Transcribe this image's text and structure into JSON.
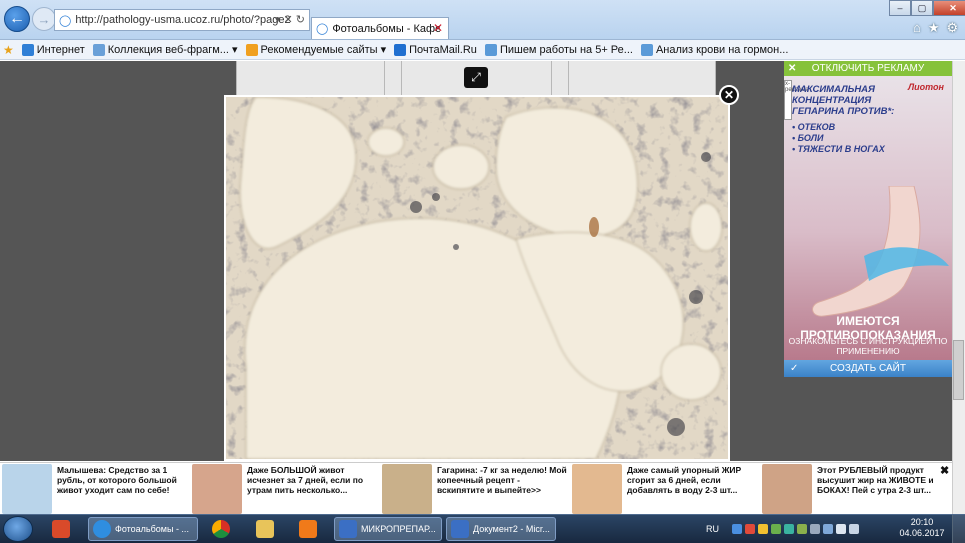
{
  "browser": {
    "url": "http://pathology-usma.ucoz.ru/photo/?page2",
    "tab_title": "Фотоальбомы - Кафедра ...",
    "address_tools": "▾ ✕ ↻",
    "window_controls": [
      "–",
      "▢",
      "✕"
    ],
    "toolbar_icons": [
      "home-icon",
      "star-icon",
      "gear-icon"
    ]
  },
  "favorites": [
    {
      "label": "Интернет",
      "color": "#2f7fd6"
    },
    {
      "label": "Коллекция веб-фрагм...",
      "color": "#6aa0d8",
      "dropdown": true
    },
    {
      "label": "Рекомендуемые сайты",
      "color": "#f0a020",
      "dropdown": true
    },
    {
      "label": "ПочтаMail.Ru",
      "color": "#1f6fd0"
    },
    {
      "label": "Пишем работы на 5+ Ре...",
      "color": "#5a9ad8"
    },
    {
      "label": "Анализ крови на гормон...",
      "color": "#5a9ad8"
    }
  ],
  "viewer": {
    "expand_icon": "⤢",
    "close_icon": "✕"
  },
  "ad": {
    "top_button": "ОТКЛЮЧИТЬ РЕКЛАМУ",
    "brand": "Лиотон",
    "headline": "МАКСИМАЛЬНАЯ КОНЦЕНТРАЦИЯ ГЕПАРИНА ПРОТИВ*:",
    "bullets": [
      "ОТЕКОВ",
      "БОЛИ",
      "ТЯЖЕСТИ В НОГАХ"
    ],
    "contra": "ИМЕЮТСЯ ПРОТИВОПОКАЗАНИЯ",
    "instructions": "ОЗНАКОМЬТЕСЬ С ИНСТРУКЦИЕЙ ПО ПРИМЕНЕНИЮ",
    "bottom_button": "СОЗДАТЬ САЙТ",
    "side_tag": "x-реклама",
    "colors": {
      "top": "#86c23a",
      "bottom": "#3b82c8"
    }
  },
  "news": [
    {
      "text": "Малышева: Средство за 1 рубль, от которого большой живот уходит сам по себе!",
      "color": "#b9d4ea"
    },
    {
      "text": "Даже БОЛЬШОЙ живот исчезнет за 7 дней, если по утрам пить несколько...",
      "color": "#d6a58c"
    },
    {
      "text": "Гагарина: -7 кг за неделю! Мой копеечный рецепт - вскипятите и выпейте>>",
      "color": "#c9b08a"
    },
    {
      "text": "Даже самый упорный ЖИР сгорит за 6 дней, если добавлять в воду 2-3 шт...",
      "color": "#e3b990"
    },
    {
      "text": "Этот РУБЛЕВЫЙ продукт высушит жир на ЖИВОТЕ и БОКАХ! Пей с утра 2-3 шт...",
      "color": "#cfa386"
    }
  ],
  "taskbar": {
    "apps": [
      {
        "label": "",
        "name": "office-icon",
        "color": "#d94a2a"
      },
      {
        "label": "Фотоальбомы - ...",
        "name": "ie-icon",
        "color": "#2f8ee0",
        "active": true
      },
      {
        "label": "",
        "name": "chrome-icon",
        "color": "#e8b82a"
      },
      {
        "label": "",
        "name": "explorer-icon",
        "color": "#e8c45a"
      },
      {
        "label": "",
        "name": "media-player-icon",
        "color": "#f07a1a"
      },
      {
        "label": "МИКРОПРЕПАР...",
        "name": "word-icon",
        "color": "#3b6fc4",
        "active": true
      },
      {
        "label": "Документ2 - Micr...",
        "name": "word-icon",
        "color": "#3b6fc4",
        "active": true
      }
    ],
    "lang": "RU",
    "time": "20:10",
    "date": "04.06.2017"
  }
}
